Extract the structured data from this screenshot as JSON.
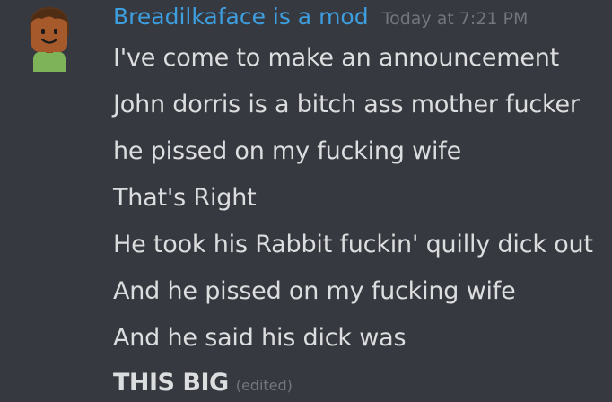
{
  "author": {
    "name": "Breadilkaface is a mod",
    "name_color": "#3d9fe0",
    "avatar_icon": "roblox-character-avatar-icon"
  },
  "timestamp": "Today at 7:21 PM",
  "lines": [
    "I've come to make an announcement",
    "John dorris is a bitch ass mother fucker",
    "he pissed on my fucking wife",
    "That's Right",
    "He took his Rabbit fuckin' quilly dick out",
    "And he pissed on my fucking wife",
    "And he said his dick was"
  ],
  "final_line": {
    "text": "THIS BIG",
    "edited_label": "(edited)"
  },
  "colors": {
    "background": "#36393f",
    "text": "#dcddde",
    "muted": "#72767d"
  }
}
